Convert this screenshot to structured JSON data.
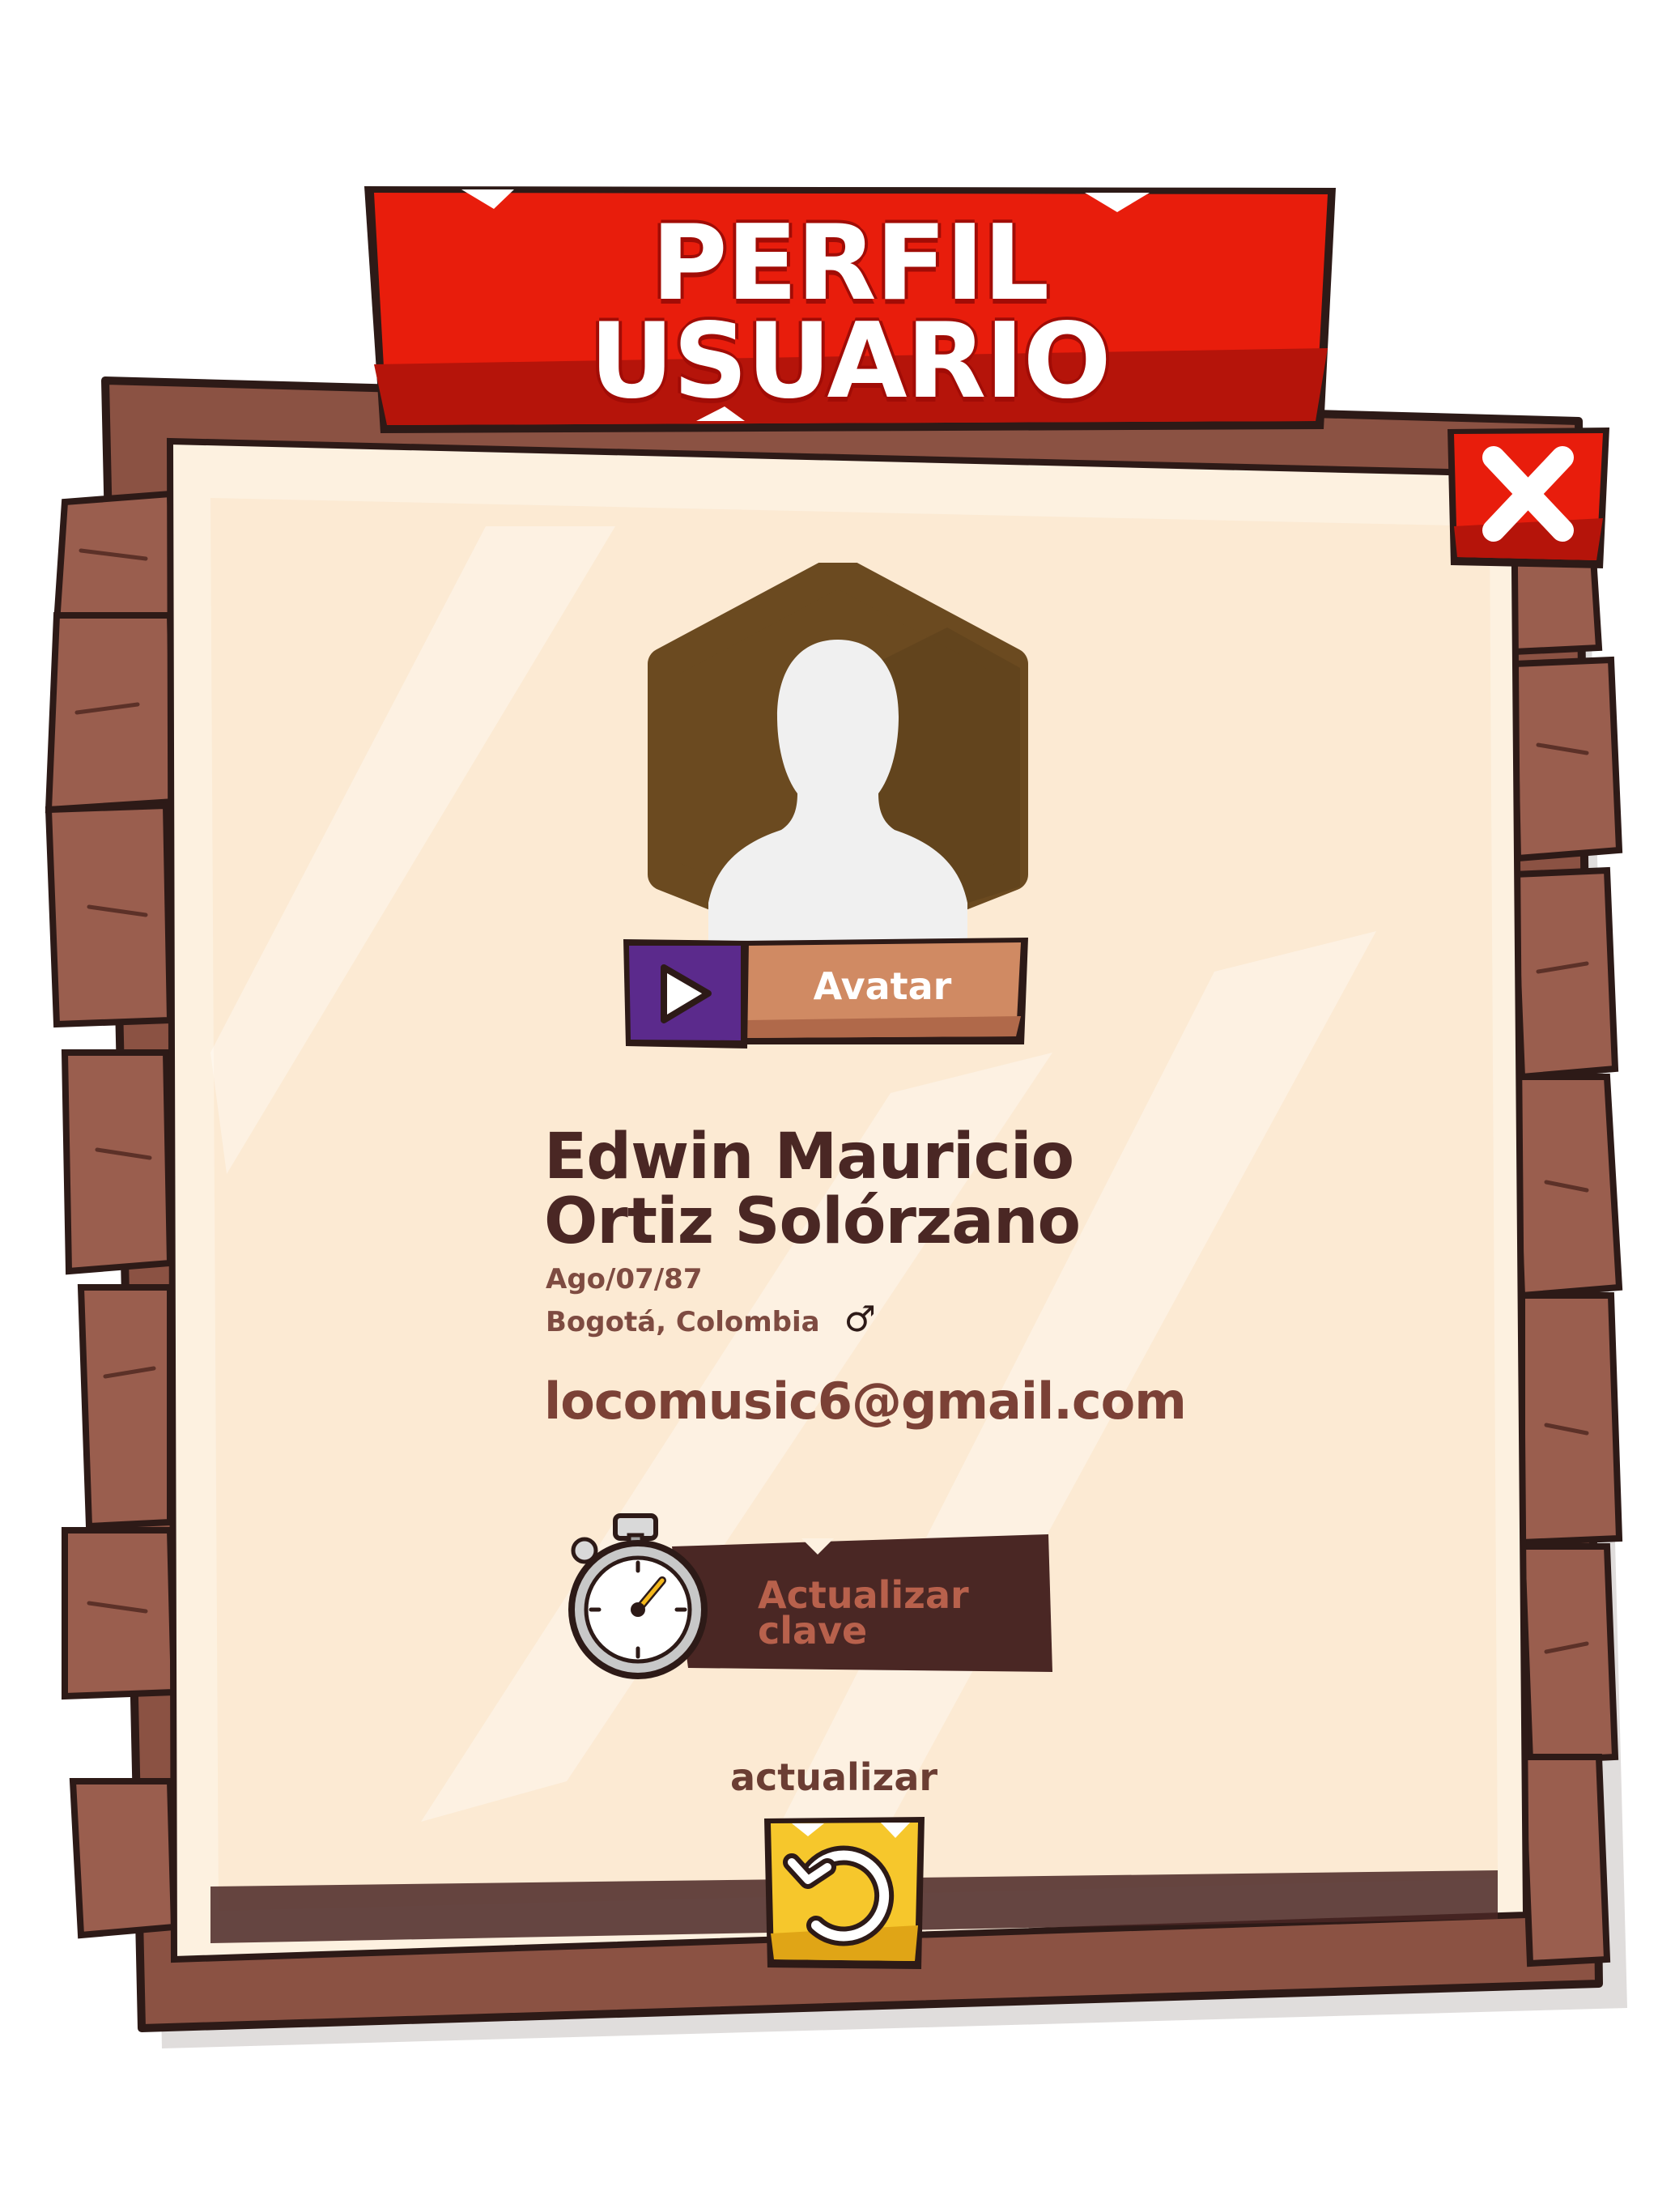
{
  "title": {
    "line1": "PERFIL",
    "line2": "USUARIO"
  },
  "close_icon": "close-icon",
  "avatar": {
    "icon": "user-silhouette-icon",
    "button_label": "Avatar",
    "play_icon": "play-icon"
  },
  "profile": {
    "first_names": "Edwin Mauricio",
    "last_names": "Ortiz Solórzano",
    "birth_date": "Ago/07/87",
    "location": "Bogotá, Colombia",
    "gender_symbol": "♂",
    "email": "locomusic6@gmail.com"
  },
  "password_button": {
    "icon": "stopwatch-icon",
    "line1": "Actualizar",
    "line2": "clave"
  },
  "refresh": {
    "label": "actualizar",
    "icon": "refresh-icon"
  },
  "colors": {
    "banner_red": "#e81d0c",
    "wood": "#8b5243",
    "wood_dark": "#4a2724",
    "paper": "#fdf1e0",
    "avatar_bg": "#6b4a20",
    "play_purple": "#5b2a8c",
    "plank_tan": "#d08a63",
    "refresh_yellow": "#f6c72c"
  }
}
